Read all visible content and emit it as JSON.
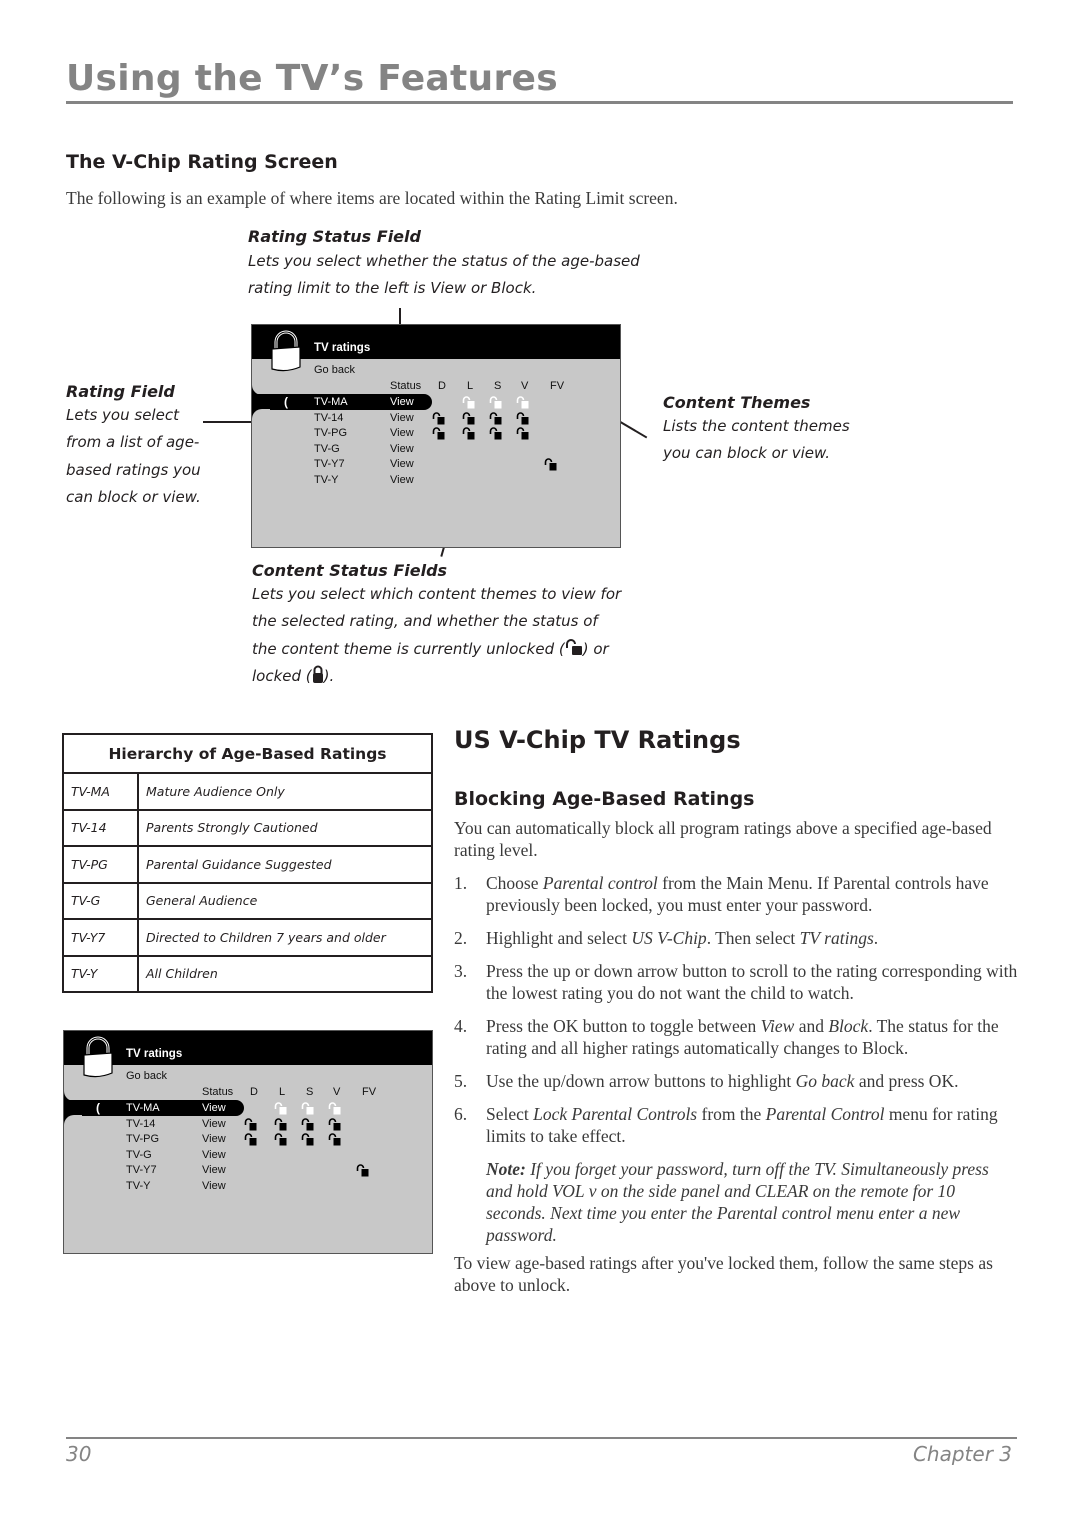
{
  "page": {
    "title": "Using the TV’s Features",
    "page_number": "30",
    "chapter": "Chapter 3"
  },
  "vchip_screen_section": {
    "heading": "The V-Chip Rating Screen",
    "intro": "The following is an example of where items are located within the Rating Limit screen.",
    "callouts": {
      "rating_status_field": {
        "title": "Rating Status Field",
        "lines": [
          "Lets you select whether the status of the age-based",
          "rating limit to the left is View or Block."
        ]
      },
      "rating_field": {
        "title": "Rating Field",
        "lines": [
          "Lets you select",
          "from a list of age-",
          "based ratings you",
          "can block or view."
        ]
      },
      "content_themes": {
        "title": "Content Themes",
        "lines": [
          "Lists the content themes",
          "you can block or view."
        ]
      },
      "content_status_fields": {
        "title": "Content Status Fields",
        "lines": [
          "Lets you select which content themes to view for",
          "the selected rating, and whether the status of",
          "the content theme is currently unlocked (",
          ") or",
          "locked (",
          ")."
        ]
      }
    }
  },
  "tv_screen": {
    "title": "TV ratings",
    "go_back": "Go back",
    "selector_glyph": "(",
    "columns": [
      "Status",
      "D",
      "L",
      "S",
      "V",
      "FV"
    ],
    "rows": [
      {
        "rating": "TV-MA",
        "status": "View",
        "selected": true,
        "themes": {
          "D": "none",
          "L": "unlocked",
          "S": "unlocked",
          "V": "unlocked",
          "FV": "none"
        }
      },
      {
        "rating": "TV-14",
        "status": "View",
        "selected": false,
        "themes": {
          "D": "unlocked",
          "L": "unlocked",
          "S": "unlocked",
          "V": "unlocked",
          "FV": "none"
        }
      },
      {
        "rating": "TV-PG",
        "status": "View",
        "selected": false,
        "themes": {
          "D": "unlocked",
          "L": "unlocked",
          "S": "unlocked",
          "V": "unlocked",
          "FV": "none"
        }
      },
      {
        "rating": "TV-G",
        "status": "View",
        "selected": false,
        "themes": {
          "D": "none",
          "L": "none",
          "S": "none",
          "V": "none",
          "FV": "none"
        }
      },
      {
        "rating": "TV-Y7",
        "status": "View",
        "selected": false,
        "themes": {
          "D": "none",
          "L": "none",
          "S": "none",
          "V": "none",
          "FV": "unlocked"
        }
      },
      {
        "rating": "TV-Y",
        "status": "View",
        "selected": false,
        "themes": {
          "D": "none",
          "L": "none",
          "S": "none",
          "V": "none",
          "FV": "none"
        }
      }
    ]
  },
  "hierarchy_table": {
    "header": "Hierarchy of Age-Based Ratings",
    "rows": [
      {
        "code": "TV-MA",
        "desc": "Mature Audience Only"
      },
      {
        "code": "TV-14",
        "desc": "Parents Strongly Cautioned"
      },
      {
        "code": "TV-PG",
        "desc": "Parental Guidance Suggested"
      },
      {
        "code": "TV-G",
        "desc": "General Audience"
      },
      {
        "code": "TV-Y7",
        "desc": "Directed to Children 7 years and older"
      },
      {
        "code": "TV-Y",
        "desc": "All Children"
      }
    ]
  },
  "us_vchip": {
    "heading": "US V-Chip TV Ratings",
    "subheading": "Blocking Age-Based Ratings",
    "intro": "You can automatically block all program ratings above a specified age-based rating level.",
    "steps": [
      {
        "num": "1.",
        "parts": [
          [
            "Choose ",
            false
          ],
          [
            "Parental control",
            true
          ],
          [
            " from the Main Menu. If Parental controls have previously been locked, you must enter your password.",
            false
          ]
        ]
      },
      {
        "num": "2.",
        "parts": [
          [
            "Highlight and select ",
            false
          ],
          [
            "US V-Chip",
            true
          ],
          [
            ". Then select ",
            false
          ],
          [
            "TV ratings",
            true
          ],
          [
            ".",
            false
          ]
        ]
      },
      {
        "num": "3.",
        "parts": [
          [
            "Press the up or down arrow button to scroll to the rating corresponding with the lowest rating you do not want the child to watch.",
            false
          ]
        ]
      },
      {
        "num": "4.",
        "parts": [
          [
            "Press the OK button to toggle between ",
            false
          ],
          [
            "View",
            true
          ],
          [
            " and ",
            false
          ],
          [
            "Block",
            true
          ],
          [
            ". The status for the rating and all higher ratings automatically changes to Block.",
            false
          ]
        ]
      },
      {
        "num": "5.",
        "parts": [
          [
            "Use the up/down arrow buttons to highlight ",
            false
          ],
          [
            "Go back",
            true
          ],
          [
            " and press OK.",
            false
          ]
        ]
      },
      {
        "num": "6.",
        "parts": [
          [
            "Select ",
            false
          ],
          [
            "Lock Parental Controls",
            true
          ],
          [
            " from the ",
            false
          ],
          [
            "Parental Control",
            true
          ],
          [
            " menu for rating limits to take effect.",
            false
          ]
        ]
      }
    ],
    "note_label": "Note:",
    "note_text": " If you forget your password, turn off the TV. Simultaneously press and hold VOL v on the side panel and CLEAR on the remote for 10 seconds. Next time you enter the Parental control menu enter a new password.",
    "outro": "To view age-based ratings after you've locked them, follow the same steps as above to unlock."
  }
}
